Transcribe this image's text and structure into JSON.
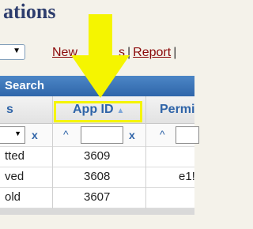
{
  "page": {
    "heading": "ations"
  },
  "links": {
    "item1": "New",
    "item2_suffix": "s",
    "item3": "Report",
    "sep": "|"
  },
  "panel": {
    "search_label": "Search",
    "col_partial": "s",
    "col_app_id": "App ID",
    "col_perm_partial": "Permi",
    "filter_x": "x",
    "filter_caret": "^",
    "rows": [
      {
        "status": "tted",
        "app_id": "3609",
        "perm": ""
      },
      {
        "status": "ved",
        "app_id": "3608",
        "perm": "e1!"
      },
      {
        "status": "old",
        "app_id": "3607",
        "perm": ""
      }
    ]
  },
  "colors": {
    "highlight": "#f5f500",
    "arrow": "#f5f500",
    "header_blue": "#2f64a8",
    "bar_blue": "#3b74b8"
  }
}
